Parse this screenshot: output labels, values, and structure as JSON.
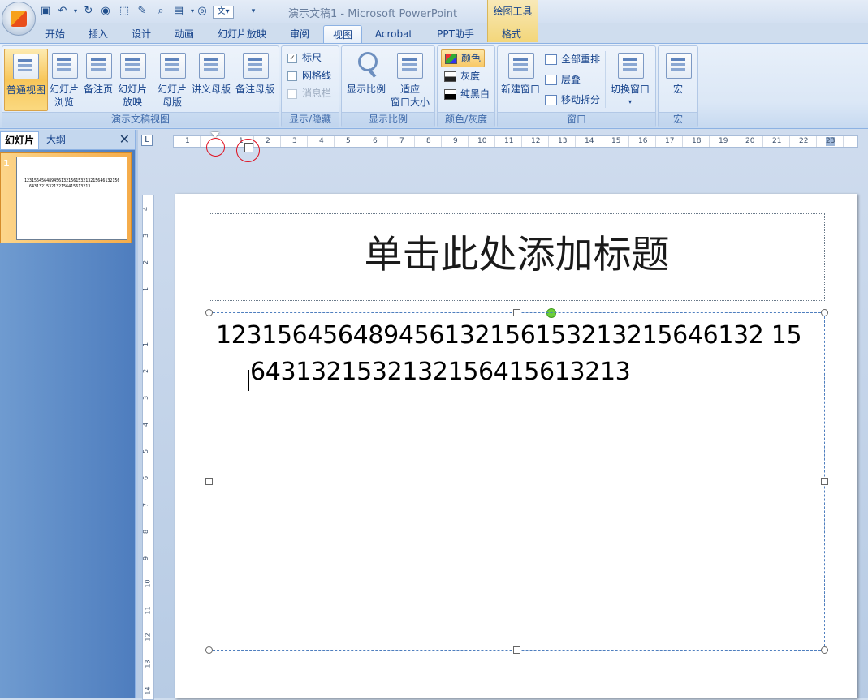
{
  "window": {
    "title": "演示文稿1 - Microsoft PowerPoint",
    "contextual_tools_label": "绘图工具"
  },
  "quick_access": {
    "icons": [
      "save-icon",
      "undo-icon",
      "dropdown-icon",
      "redo-icon",
      "spellcheck-icon",
      "select-icon",
      "format-painter-icon",
      "print-preview-icon",
      "view-icon",
      "spell-icon",
      "text-icon",
      "customize-icon"
    ]
  },
  "tabs": [
    {
      "label": "开始"
    },
    {
      "label": "插入"
    },
    {
      "label": "设计"
    },
    {
      "label": "动画"
    },
    {
      "label": "幻灯片放映"
    },
    {
      "label": "审阅"
    },
    {
      "label": "视图"
    },
    {
      "label": "Acrobat"
    },
    {
      "label": "PPT助手"
    },
    {
      "label": "格式"
    }
  ],
  "ribbon": {
    "presentation_views": {
      "label": "演示文稿视图",
      "normal": "普通视图",
      "slide_sorter_1": "幻灯片",
      "slide_sorter_2": "浏览",
      "notes_page": "备注页",
      "slide_show_1": "幻灯片",
      "slide_show_2": "放映",
      "slide_master_1": "幻灯片",
      "slide_master_2": "母版",
      "handout_master": "讲义母版",
      "notes_master": "备注母版"
    },
    "show_hide": {
      "label": "显示/隐藏",
      "ruler": "标尺",
      "gridlines": "网格线",
      "message_bar": "消息栏",
      "ruler_checked": "✓"
    },
    "zoom": {
      "label": "显示比例",
      "zoom_btn": "显示比例",
      "fit_1": "适应",
      "fit_2": "窗口大小"
    },
    "color": {
      "label": "颜色/灰度",
      "color": "颜色",
      "grayscale": "灰度",
      "pure_bw": "纯黑白"
    },
    "window": {
      "label": "窗口",
      "new_window": "新建窗口",
      "arrange_all": "全部重排",
      "cascade": "层叠",
      "move_split": "移动拆分",
      "switch_windows": "切换窗口"
    },
    "macros": {
      "label": "宏",
      "macros_btn": "宏"
    }
  },
  "left_panel": {
    "tab_slides": "幻灯片",
    "tab_outline": "大纲",
    "close": "✕",
    "slide_number": "1",
    "thumb_line_1": "123156456489456132156153213215646132156",
    "thumb_line_2": "6431321532132156415613213"
  },
  "ruler": {
    "h_numbers": [
      "1",
      "1",
      "2",
      "3",
      "4",
      "5",
      "6",
      "7",
      "8",
      "9",
      "10",
      "11",
      "12",
      "13",
      "14",
      "15",
      "16",
      "17",
      "18",
      "19",
      "20",
      "21",
      "22",
      "23"
    ],
    "v_numbers": [
      "4",
      "3",
      "2",
      "1",
      "1",
      "2",
      "3",
      "4",
      "5",
      "6",
      "7",
      "8",
      "9",
      "10",
      "11",
      "12",
      "13",
      "14"
    ],
    "corner": "L"
  },
  "slide": {
    "title_placeholder": "单击此处添加标题",
    "body_line_1": "123156456489456132156153213215646132 15",
    "body_line_2": "6431321532132156415613213"
  }
}
